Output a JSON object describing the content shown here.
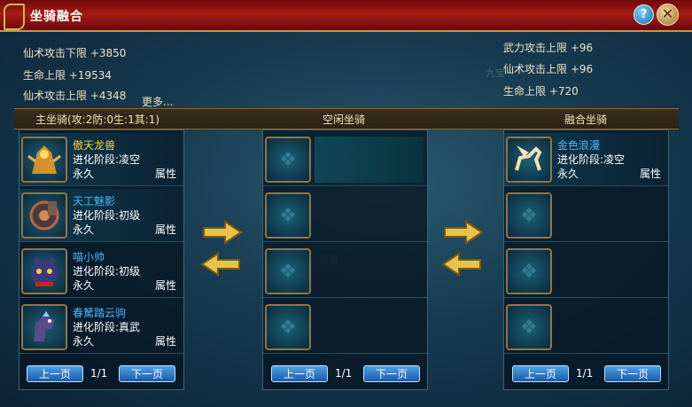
{
  "window": {
    "title": "坐骑融合",
    "help_label": "?",
    "close_label": "✕"
  },
  "stats_left": [
    "仙术攻击下限 +3850",
    "生命上限 +19534",
    "仙术攻击上限 +4348"
  ],
  "more_label": "更多...",
  "stats_right": [
    "武力攻击上限 +96",
    "仙术攻击上限 +96",
    "生命上限 +720"
  ],
  "columns": {
    "main": "主坐骑(攻:2防:0生:1其:1)",
    "idle": "空闲坐骑",
    "fused": "融合坐骑"
  },
  "main_mounts": [
    {
      "name": "傲天龙兽",
      "stage": "进化阶段:凌空",
      "duration": "永久",
      "attr": "属性",
      "icon": "dragon-beast-icon"
    },
    {
      "name": "天工魅影",
      "stage": "进化阶段:初级",
      "duration": "永久",
      "attr": "属性",
      "icon": "mecha-wheel-icon"
    },
    {
      "name": "喵小帅",
      "stage": "进化阶段:初级",
      "duration": "永久",
      "attr": "属性",
      "icon": "cat-face-icon"
    },
    {
      "name": "春駑踏云驹",
      "stage": "进化阶段:真武",
      "duration": "永久",
      "attr": "属性",
      "icon": "horse-head-icon"
    }
  ],
  "fused_mounts": [
    {
      "name": "金色浪漫",
      "stage": "进化阶段:凌空",
      "duration": "永久",
      "attr": "属性",
      "icon": "golden-pegasus-icon"
    }
  ],
  "pager": {
    "prev": "上一页",
    "next": "下一页",
    "main_count": "1/1",
    "idle_count": "1/1",
    "fused_count": "1/1"
  },
  "background_hints": {
    "world_npc": "九宝",
    "world_npc2": "黄黄"
  }
}
